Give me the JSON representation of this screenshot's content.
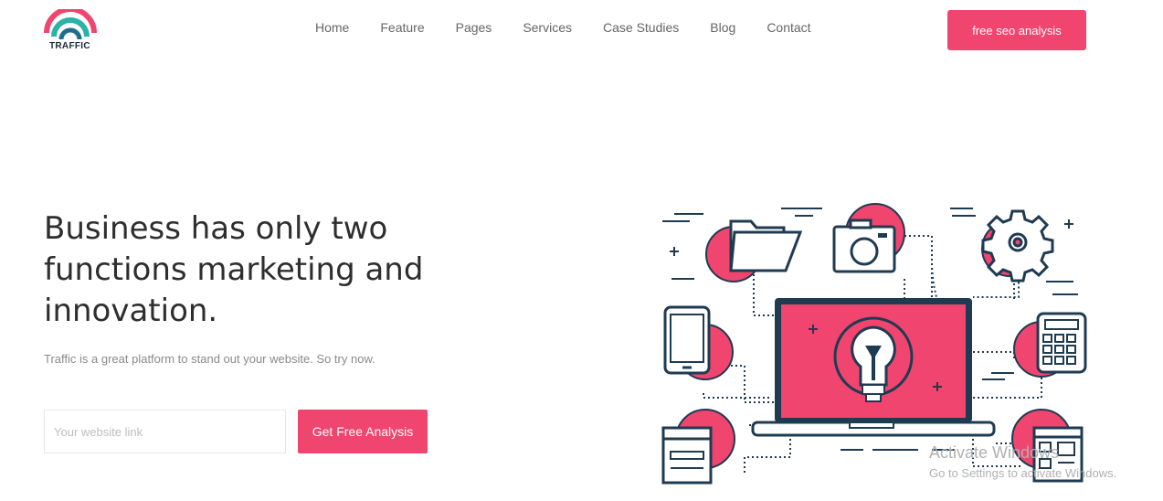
{
  "brand": {
    "name": "TRAFFIC"
  },
  "nav": {
    "items": [
      "Home",
      "Feature",
      "Pages",
      "Services",
      "Case Studies",
      "Blog",
      "Contact"
    ]
  },
  "header": {
    "cta_label": "free seo analysis"
  },
  "hero": {
    "title": "Business has only two functions marketing and innovation.",
    "subtitle": "Traffic is a great platform to stand out your website. So try now.",
    "input_placeholder": "Your website link",
    "button_label": "Get Free Analysis"
  },
  "watermark": {
    "line1": "Activate Windows",
    "line2": "Go to Settings to activate Windows."
  },
  "colors": {
    "accent": "#f0456f",
    "dark": "#1f2b3d",
    "teal": "#2ab3a6"
  },
  "icons": [
    "folder-icon",
    "camera-icon",
    "gear-icon",
    "phone-icon",
    "laptop-icon",
    "lightbulb-icon",
    "calculator-icon",
    "browser-window-icon",
    "document-grid-icon"
  ]
}
